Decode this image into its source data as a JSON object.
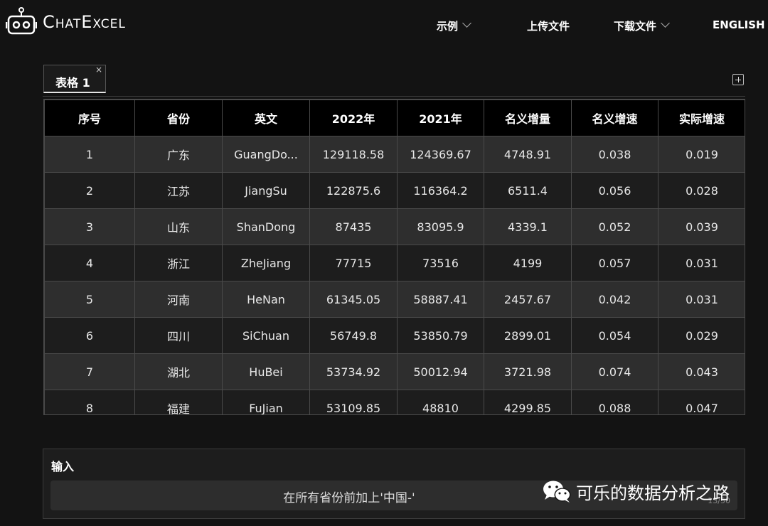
{
  "app": {
    "logo_text": "ChatExcel"
  },
  "nav": {
    "examples": "示例",
    "upload": "上传文件",
    "download": "下载文件",
    "language": "ENGLISH"
  },
  "tabs": [
    {
      "label": "表格 1",
      "close": "×"
    }
  ],
  "table": {
    "headers": [
      "序号",
      "省份",
      "英文",
      "2022年",
      "2021年",
      "名义增量",
      "名义增速",
      "实际增速"
    ],
    "rows": [
      [
        "1",
        "广东",
        "GuangDo...",
        "129118.58",
        "124369.67",
        "4748.91",
        "0.038",
        "0.019"
      ],
      [
        "2",
        "江苏",
        "JiangSu",
        "122875.6",
        "116364.2",
        "6511.4",
        "0.056",
        "0.028"
      ],
      [
        "3",
        "山东",
        "ShanDong",
        "87435",
        "83095.9",
        "4339.1",
        "0.052",
        "0.039"
      ],
      [
        "4",
        "浙江",
        "ZheJiang",
        "77715",
        "73516",
        "4199",
        "0.057",
        "0.031"
      ],
      [
        "5",
        "河南",
        "HeNan",
        "61345.05",
        "58887.41",
        "2457.67",
        "0.042",
        "0.031"
      ],
      [
        "6",
        "四川",
        "SiChuan",
        "56749.8",
        "53850.79",
        "2899.01",
        "0.054",
        "0.029"
      ],
      [
        "7",
        "湖北",
        "HuBei",
        "53734.92",
        "50012.94",
        "3721.98",
        "0.074",
        "0.043"
      ],
      [
        "8",
        "福建",
        "FuJian",
        "53109.85",
        "48810",
        "4299.85",
        "0.088",
        "0.047"
      ]
    ]
  },
  "input": {
    "label": "输入",
    "value": "在所有省份前加上'中国-'",
    "counter": "13/50"
  },
  "watermark": {
    "text": "可乐的数据分析之路"
  },
  "colors": {
    "background": "#131313",
    "header_row": "#000000",
    "row_odd": "#2e2e2e",
    "row_even": "#1d1d1d"
  }
}
